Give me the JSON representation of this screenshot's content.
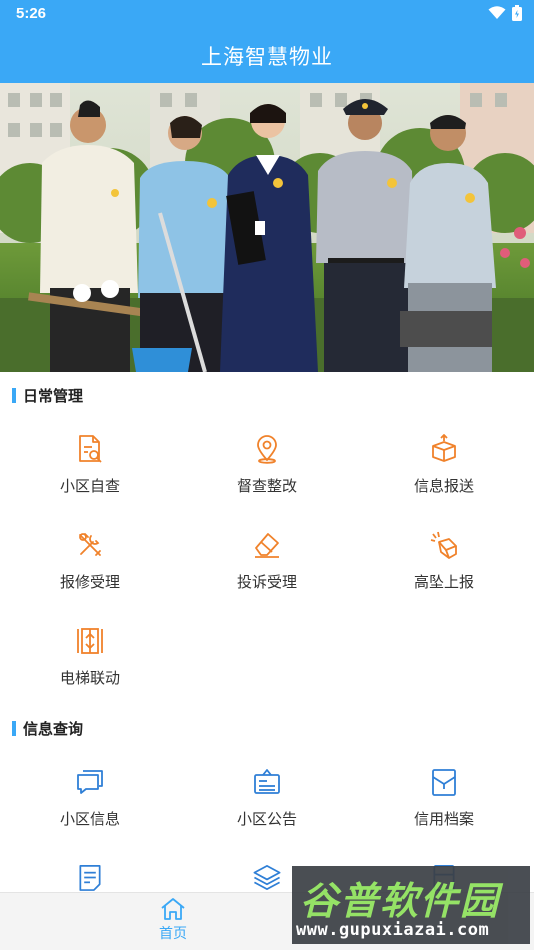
{
  "status_bar": {
    "time": "5:26"
  },
  "header": {
    "title": "上海智慧物业"
  },
  "sections": [
    {
      "title": "日常管理",
      "items": [
        {
          "label": "小区自查",
          "icon": "document-search-icon"
        },
        {
          "label": "督查整改",
          "icon": "location-pin-icon"
        },
        {
          "label": "信息报送",
          "icon": "box-upload-icon"
        },
        {
          "label": "报修受理",
          "icon": "tools-icon"
        },
        {
          "label": "投诉受理",
          "icon": "eraser-icon"
        },
        {
          "label": "高坠上报",
          "icon": "falling-box-icon"
        },
        {
          "label": "电梯联动",
          "icon": "elevator-icon"
        }
      ]
    },
    {
      "title": "信息查询",
      "items": [
        {
          "label": "小区信息",
          "icon": "chat-bubbles-icon"
        },
        {
          "label": "小区公告",
          "icon": "notice-board-icon"
        },
        {
          "label": "信用档案",
          "icon": "archive-folder-icon"
        }
      ]
    }
  ],
  "bottom_nav": {
    "home_label": "首页"
  },
  "watermark": {
    "brand": "谷普软件园",
    "url": "www.gupuxiazai.com"
  },
  "colors": {
    "primary": "#3aa8f6",
    "icon_orange": "#f0822b",
    "icon_blue": "#2f7fd6"
  }
}
